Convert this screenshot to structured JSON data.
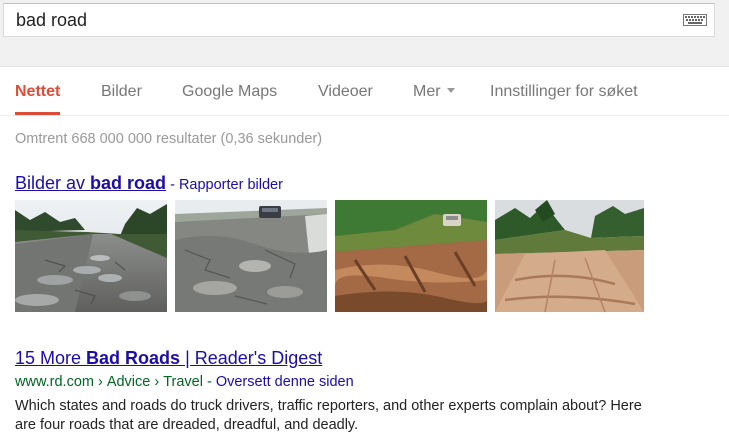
{
  "search": {
    "query": "bad road",
    "keyboard_icon": "keyboard-icon"
  },
  "tabs": [
    {
      "label": "Nettet",
      "active": true
    },
    {
      "label": "Bilder"
    },
    {
      "label": "Google Maps"
    },
    {
      "label": "Videoer"
    },
    {
      "label": "Mer"
    },
    {
      "label": "Innstillinger for søket"
    }
  ],
  "stats": "Omtrent 668 000 000 resultater (0,36 sekunder)",
  "images": {
    "title_prefix": "Bilder av ",
    "title_bold": "bad road",
    "dash": " - ",
    "report": "Rapporter bilder"
  },
  "result": {
    "title_prefix": "15 More ",
    "title_bold": "Bad Roads",
    "title_suffix": " | Reader's Digest",
    "url_domain": "www.rd.com",
    "breadcrumb_sep": "›",
    "breadcrumb_1": "Advice",
    "breadcrumb_2": "Travel",
    "translate_sep": " - ",
    "translate": "Oversett denne siden",
    "snippet": "Which states and roads do truck drivers, traffic reporters, and other experts complain about? Here are four roads that are dreaded, dreadful, and deadly."
  },
  "colors": {
    "accent": "#dd4b39",
    "link": "#1a0dab",
    "url_green": "#006621",
    "muted": "#999999"
  }
}
